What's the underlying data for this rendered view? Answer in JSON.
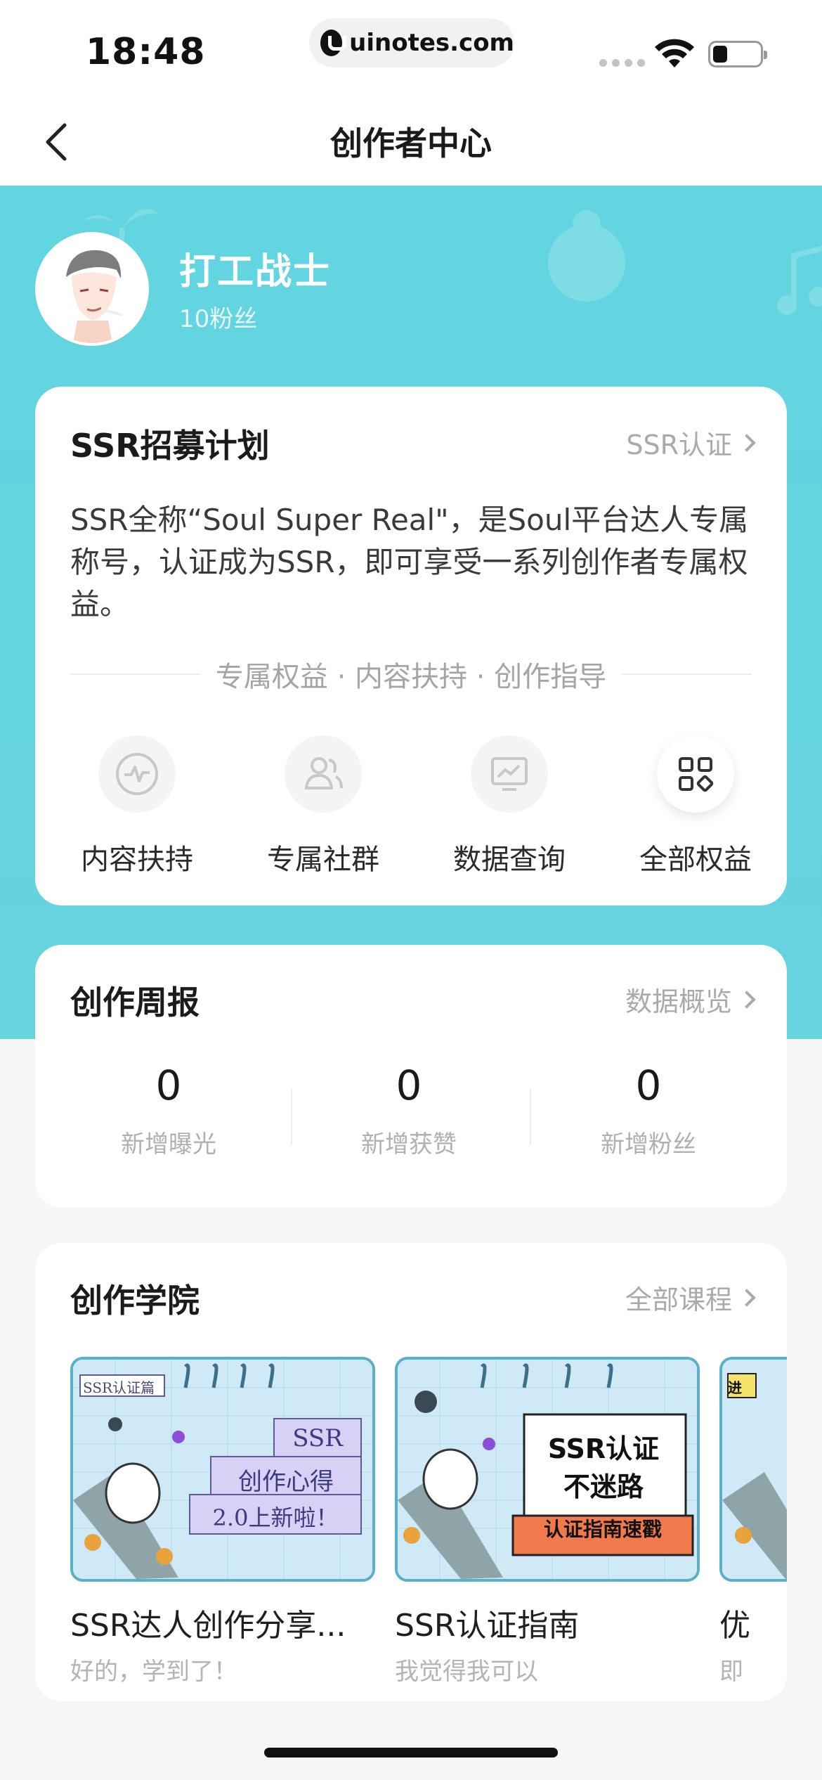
{
  "status_bar": {
    "time": "18:48",
    "url": "uinotes.com"
  },
  "nav": {
    "title": "创作者中心"
  },
  "profile": {
    "name": "打工战士",
    "fans": "10粉丝"
  },
  "ssr_card": {
    "title": "SSR招募计划",
    "link": "SSR认证",
    "description": "SSR全称“Soul Super Real\"，是Soul平台达人专属称号，认证成为SSR，即可享受一系列创作者专属权益。",
    "divider": "专属权益 · 内容扶持 · 创作指导",
    "benefits": [
      {
        "label": "内容扶持",
        "icon": "pulse-icon"
      },
      {
        "label": "专属社群",
        "icon": "community-icon"
      },
      {
        "label": "数据查询",
        "icon": "data-chart-icon"
      },
      {
        "label": "全部权益",
        "icon": "grid-icon"
      }
    ]
  },
  "weekly_card": {
    "title": "创作周报",
    "link": "数据概览",
    "stats": [
      {
        "value": "0",
        "label": "新增曝光"
      },
      {
        "value": "0",
        "label": "新增获赞"
      },
      {
        "value": "0",
        "label": "新增粉丝"
      }
    ]
  },
  "academy_card": {
    "title": "创作学院",
    "link": "全部课程",
    "courses": [
      {
        "title": "SSR达人创作分享...",
        "subtitle": "好的，学到了！",
        "thumb_tag": "SSR认证篇",
        "thumb_lines": [
          "SSR",
          "创作心得",
          "2.0上新啦！"
        ]
      },
      {
        "title": "SSR认证指南",
        "subtitle": "我觉得我可以",
        "thumb_lines": [
          "SSR认证",
          "不迷路",
          "认证指南速戳"
        ]
      },
      {
        "title": "优",
        "subtitle": "即",
        "thumb_tag": "进"
      }
    ]
  },
  "colors": {
    "hero": "#62d5e0",
    "card": "#ffffff",
    "muted": "#aaaaaa"
  }
}
